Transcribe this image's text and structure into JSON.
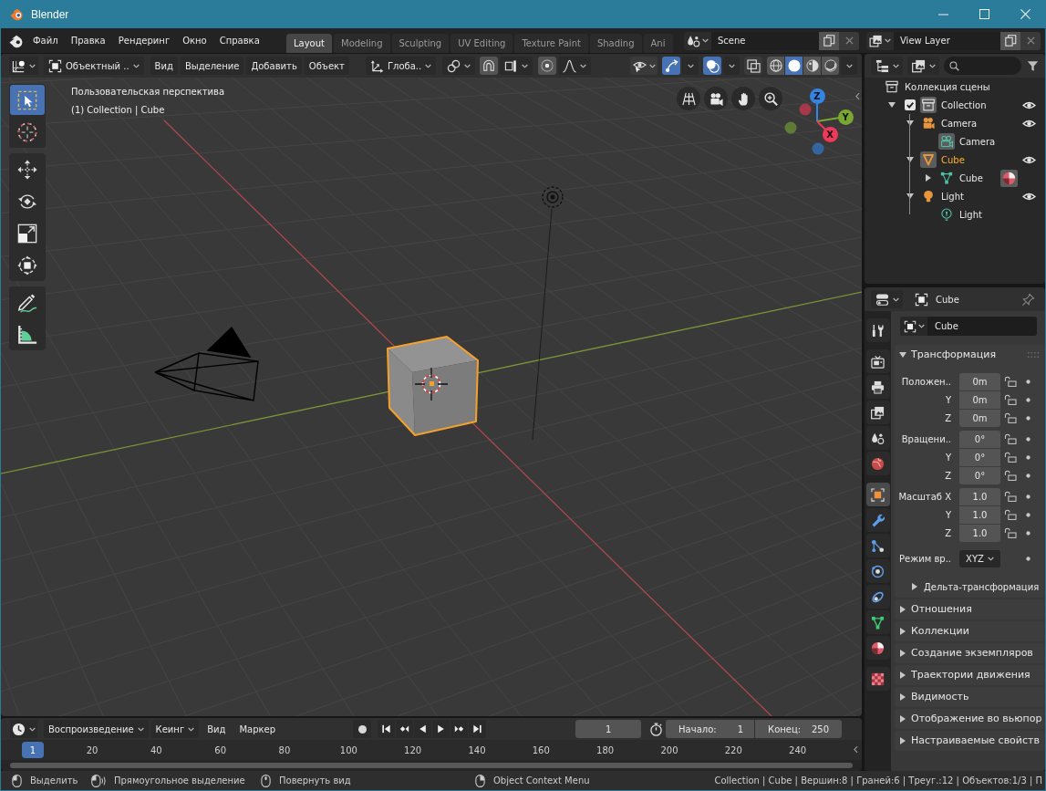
{
  "window": {
    "title": "Blender"
  },
  "menu": [
    "Файл",
    "Правка",
    "Рендеринг",
    "Окно",
    "Справка"
  ],
  "workspaces": [
    {
      "label": "Layout",
      "selected": true
    },
    {
      "label": "Modeling",
      "selected": false
    },
    {
      "label": "Sculpting",
      "selected": false
    },
    {
      "label": "UV Editing",
      "selected": false
    },
    {
      "label": "Texture Paint",
      "selected": false
    },
    {
      "label": "Shading",
      "selected": false
    },
    {
      "label": "Ani",
      "selected": false
    }
  ],
  "scene": {
    "value": "Scene"
  },
  "view_layer": {
    "value": "View Layer"
  },
  "viewport_header": {
    "mode": "Объектный ..",
    "menus": [
      "Вид",
      "Выделение",
      "Добавить",
      "Объект"
    ],
    "orientation": "Глоба..",
    "snap": {
      "on": false
    },
    "proportional": {
      "on": false
    },
    "toggles": [
      {
        "kind": "visibility",
        "on": false
      },
      {
        "kind": "gizmos",
        "on": true
      },
      {
        "kind": "overlays",
        "on": true
      },
      {
        "kind": "xray",
        "on": false
      }
    ],
    "shading": [
      {
        "kind": "wireframe",
        "selected": false
      },
      {
        "kind": "solid",
        "selected": true
      },
      {
        "kind": "material",
        "selected": false
      },
      {
        "kind": "rendered",
        "selected": false
      }
    ]
  },
  "viewport": {
    "view_name": "Пользовательская перспектива",
    "context": "(1) Collection | Cube",
    "tools": [
      [
        {
          "kind": "select_box",
          "selected": true
        },
        {
          "kind": "cursor",
          "selected": false
        }
      ],
      [
        {
          "kind": "move",
          "selected": false
        },
        {
          "kind": "rotate",
          "selected": false
        },
        {
          "kind": "scale",
          "selected": false
        },
        {
          "kind": "transform",
          "selected": false
        }
      ],
      [
        {
          "kind": "annotate",
          "selected": false
        },
        {
          "kind": "measure",
          "selected": false
        }
      ]
    ],
    "nav_buttons": [
      {
        "kind": "ortho"
      },
      {
        "kind": "camera"
      },
      {
        "kind": "pan"
      },
      {
        "kind": "zoom"
      }
    ],
    "axes": [
      {
        "label": "Z",
        "color": "#3484e4"
      },
      {
        "label": "Y",
        "color": "#7aa632"
      },
      {
        "label": "X",
        "color": "#f0385a"
      }
    ]
  },
  "outliner": {
    "tree": [
      {
        "label": "Коллекция сцены",
        "kind": "scene_collection",
        "active": false,
        "selected": false,
        "children": [
          {
            "label": "Collection",
            "kind": "collection",
            "expanded": true,
            "checked": true,
            "visible": true,
            "active": true,
            "selected": false,
            "children": [
              {
                "label": "Camera",
                "kind": "camera",
                "expanded": true,
                "visible": true,
                "active": false,
                "selected": false,
                "children": [
                  {
                    "label": "Camera",
                    "kind": "camera_data",
                    "active": true,
                    "selected": false
                  }
                ]
              },
              {
                "label": "Cube",
                "kind": "mesh_object",
                "expanded": true,
                "visible": true,
                "active": true,
                "selected": true,
                "children": [
                  {
                    "label": "Cube",
                    "kind": "mesh",
                    "expanded": false,
                    "active": false,
                    "selected": false
                  }
                ]
              },
              {
                "label": "Light",
                "kind": "light",
                "expanded": true,
                "visible": true,
                "active": false,
                "selected": false,
                "children": [
                  {
                    "label": "Light",
                    "kind": "light_data",
                    "active": false,
                    "selected": false
                  }
                ]
              }
            ]
          }
        ]
      }
    ]
  },
  "properties": {
    "header": "Cube",
    "tabs": [
      [
        {
          "kind": "tool",
          "selected": false
        }
      ],
      [
        {
          "kind": "render",
          "selected": false
        },
        {
          "kind": "output",
          "selected": false
        },
        {
          "kind": "view_layer",
          "selected": false
        },
        {
          "kind": "scene",
          "selected": false
        },
        {
          "kind": "world",
          "selected": false
        }
      ],
      [
        {
          "kind": "object",
          "selected": true
        },
        {
          "kind": "modifiers",
          "selected": false
        },
        {
          "kind": "particles",
          "selected": false
        },
        {
          "kind": "physics",
          "selected": false
        },
        {
          "kind": "constraints",
          "selected": false
        },
        {
          "kind": "data",
          "selected": false
        },
        {
          "kind": "material",
          "selected": false
        }
      ],
      [
        {
          "kind": "texture",
          "selected": false
        }
      ]
    ],
    "object_name": "Cube",
    "panels": [
      {
        "title": "Трансформация",
        "expanded": true,
        "groups": [
          [
            {
              "kind": "number",
              "label": "Положен..",
              "value": "0m",
              "locked": false
            },
            {
              "kind": "number",
              "label": "Y",
              "value": "0m",
              "locked": false
            },
            {
              "kind": "number",
              "label": "Z",
              "value": "0m",
              "locked": false
            }
          ],
          [
            {
              "kind": "number",
              "label": "Вращени..",
              "value": "0°",
              "locked": false
            },
            {
              "kind": "number",
              "label": "Y",
              "value": "0°",
              "locked": false
            },
            {
              "kind": "number",
              "label": "Z",
              "value": "0°",
              "locked": false
            }
          ],
          [
            {
              "kind": "number",
              "label": "Масштаб X",
              "value": "1.0",
              "locked": false
            },
            {
              "kind": "number",
              "label": "Y",
              "value": "1.0",
              "locked": false
            },
            {
              "kind": "number",
              "label": "Z",
              "value": "1.0",
              "locked": false
            }
          ],
          [
            {
              "kind": "dropdown",
              "label": "Режим вр..",
              "value": "XYZ"
            }
          ]
        ],
        "subpanels": [
          {
            "title": "Дельта-трансформация",
            "expanded": false
          }
        ]
      },
      {
        "title": "Отношения",
        "expanded": false
      },
      {
        "title": "Коллекции",
        "expanded": false
      },
      {
        "title": "Создание экземпляров",
        "expanded": false
      },
      {
        "title": "Траектории движения",
        "expanded": false
      },
      {
        "title": "Видимость",
        "expanded": false
      },
      {
        "title": "Отображение во вьюпор",
        "expanded": false
      },
      {
        "title": "Настраиваемые свойств",
        "expanded": false
      }
    ]
  },
  "timeline": {
    "menus": [
      {
        "label": "Воспроизведение",
        "kind": "dropdown"
      },
      {
        "label": "Кеинг",
        "kind": "dropdown"
      },
      {
        "label": "Вид",
        "kind": "menu"
      },
      {
        "label": "Маркер",
        "kind": "menu"
      }
    ],
    "autokey": {
      "on": false
    },
    "transport": [
      {
        "kind": "jump_start"
      },
      {
        "kind": "prev_key"
      },
      {
        "kind": "play_reverse"
      },
      {
        "kind": "play"
      },
      {
        "kind": "next_key"
      },
      {
        "kind": "jump_end"
      }
    ],
    "current_frame": "1",
    "start": {
      "label": "Начало:",
      "value": "1"
    },
    "end": {
      "label": "Конец:",
      "value": "250"
    },
    "playhead": "1",
    "ticks": [
      "20",
      "40",
      "60",
      "80",
      "100",
      "120",
      "140",
      "160",
      "180",
      "200",
      "220",
      "240"
    ]
  },
  "status_bar": {
    "hints": [
      {
        "kind": "left_click",
        "label": "Выделить"
      },
      {
        "kind": "left_drag",
        "label": "Прямоугольное выделение"
      },
      {
        "kind": "middle_click",
        "label": "Повернуть вид"
      },
      {
        "kind": "right_click",
        "label": "Object Context Menu"
      }
    ],
    "stats": "Collection | Cube | Вершин:8 | Граней:6 | Треуг.:12 | Объектов:1/3 | П"
  }
}
